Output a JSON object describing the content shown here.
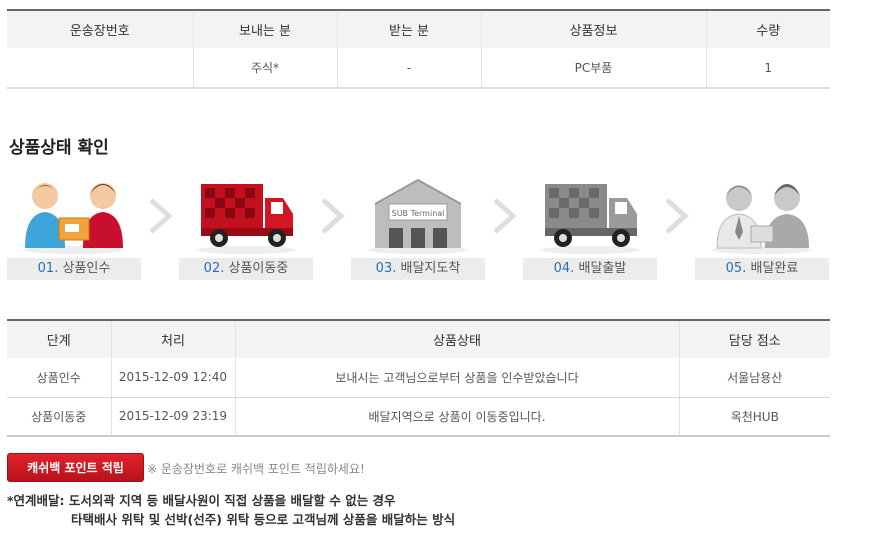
{
  "shipment_table": {
    "headers": [
      "운송장번호",
      "보내는 분",
      "받는 분",
      "상품정보",
      "수량"
    ],
    "row": [
      "",
      "주식*",
      "-",
      "PC부품",
      "1"
    ]
  },
  "section_title": "상품상태 확인",
  "steps": [
    {
      "num": "01.",
      "label": "상품인수",
      "icon": "handover-people-icon"
    },
    {
      "num": "02.",
      "label": "상품이동중",
      "icon": "red-truck-icon"
    },
    {
      "num": "03.",
      "label": "배달지도착",
      "icon": "warehouse-icon",
      "sign": "SUB Terminal"
    },
    {
      "num": "04.",
      "label": "배달출발",
      "icon": "gray-truck-icon"
    },
    {
      "num": "05.",
      "label": "배달완료",
      "icon": "delivered-people-icon"
    }
  ],
  "status_table": {
    "headers": [
      "단계",
      "처리",
      "상품상태",
      "담당 점소"
    ],
    "rows": [
      [
        "상품인수",
        "2015-12-09 12:40",
        "보내시는 고객님으로부터 상품을 인수받았습니다",
        "서울남용산"
      ],
      [
        "상품이동중",
        "2015-12-09 23:19",
        "배달지역으로 상품이 이동중입니다.",
        "옥천HUB"
      ]
    ]
  },
  "cashback": {
    "button_label": "캐쉬백 포인트 적립",
    "note": "※ 운송장번호로 캐쉬백 포인트 적립하세요!"
  },
  "footnote": {
    "line1": "*연계배달: 도서외곽 지역 등 배달사원이 직접 상품을 배달할 수 없는 경우",
    "line2": "타택배사 위탁 및 선박(선주) 위탁 등으로 고객님께 상품을 배달하는 방식"
  },
  "colors": {
    "accent_red": "#d01a22",
    "step_number": "#2a6fb5",
    "header_bg": "#f3f3f3"
  }
}
